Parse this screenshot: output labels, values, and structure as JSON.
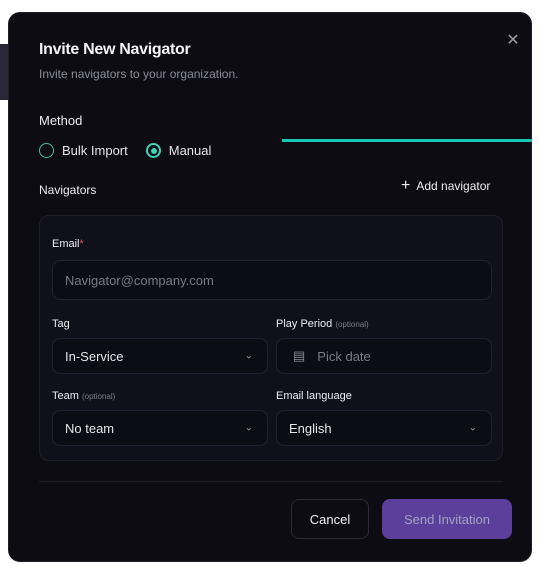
{
  "dialog": {
    "title": "Invite New Navigator",
    "subtitle": "Invite navigators to your organization.",
    "close_icon": "close-icon"
  },
  "method": {
    "label": "Method",
    "options": [
      {
        "label": "Bulk Import",
        "selected": false
      },
      {
        "label": "Manual",
        "selected": true
      }
    ]
  },
  "navigators": {
    "label": "Navigators",
    "add_label": "Add navigator"
  },
  "form": {
    "email": {
      "label": "Email",
      "required_mark": "*",
      "placeholder": "Navigator@company.com"
    },
    "tag": {
      "label": "Tag",
      "value": "In-Service"
    },
    "play_period": {
      "label": "Play Period",
      "optional": "(optional)",
      "placeholder": "Pick date"
    },
    "team": {
      "label": "Team",
      "optional": "(optional)",
      "value": "No team"
    },
    "email_language": {
      "label": "Email language",
      "value": "English"
    }
  },
  "actions": {
    "cancel": "Cancel",
    "send": "Send Invitation"
  },
  "colors": {
    "accent": "#17c7b3",
    "primary_button": "#5b3f9a",
    "dialog_bg": "#0c0c12"
  }
}
